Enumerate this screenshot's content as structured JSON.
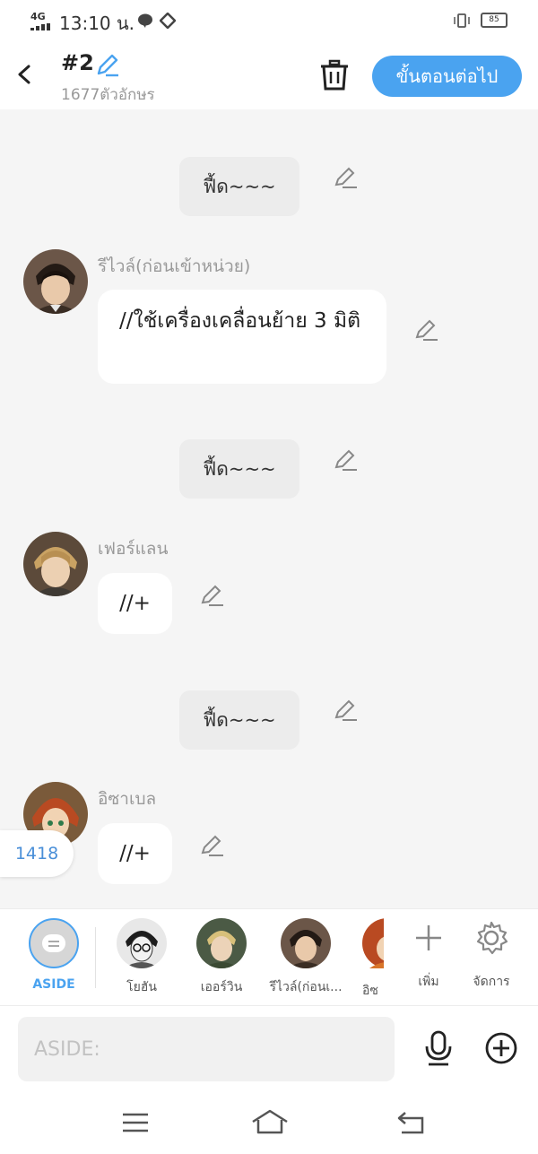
{
  "status": {
    "network": "4G",
    "time": "13:10 น.",
    "battery": "85"
  },
  "header": {
    "title": "#2",
    "subtitle": "1677ตัวอักษร",
    "next_label": "ขั้นตอนต่อไป"
  },
  "messages": [
    {
      "type": "narration",
      "text": "ฟี้ด~~~"
    },
    {
      "type": "dialog",
      "name": "รีไวล์(ก่อนเข้าหน่วย)",
      "text": "//ใช้เครื่องเคลื่อนย้าย 3 มิติ"
    },
    {
      "type": "narration",
      "text": "ฟี้ด~~~"
    },
    {
      "type": "dialog",
      "name": "เฟอร์แลน",
      "text": "//+"
    },
    {
      "type": "narration",
      "text": "ฟี้ด~~~"
    },
    {
      "type": "dialog",
      "name": "อิซาเบล",
      "text": "//+"
    }
  ],
  "count_badge": "1418",
  "characters": [
    {
      "label": "ASIDE"
    },
    {
      "label": "โยฮัน"
    },
    {
      "label": "เออร์วิน"
    },
    {
      "label": "รีไวล์(ก่อนเ..."
    },
    {
      "label": "อิซ"
    }
  ],
  "actions": {
    "add_label": "เพิ่ม",
    "manage_label": "จัดการ"
  },
  "input": {
    "placeholder": "ASIDE:"
  },
  "colors": {
    "accent": "#4aa3f0",
    "background": "#f5f5f5"
  }
}
